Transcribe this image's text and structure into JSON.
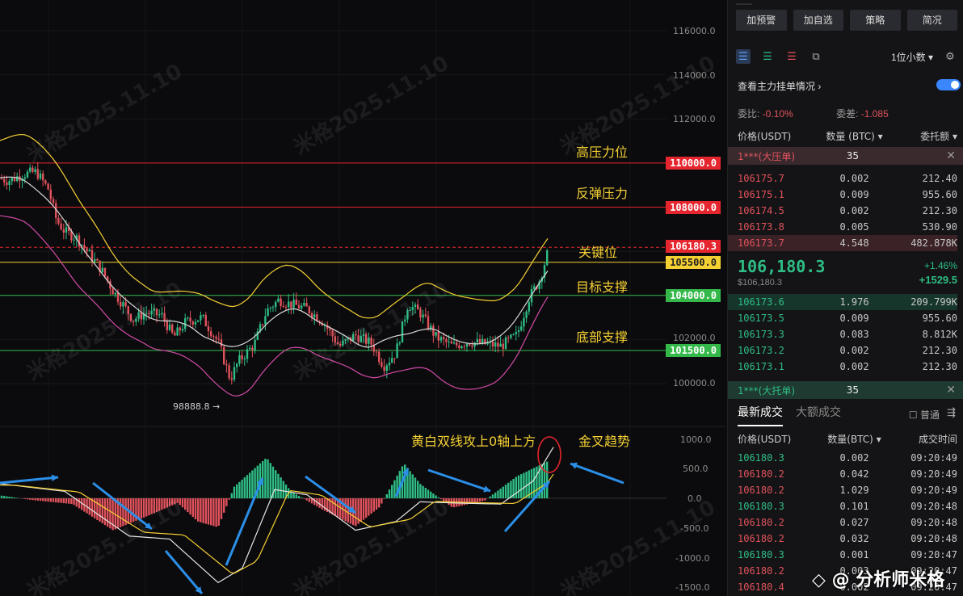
{
  "chart": {
    "y_axis_labels": [
      "116000.0",
      "114000.0",
      "112000.0",
      "110000.0",
      "108000.0",
      "106000.0",
      "104000.0",
      "102000.0",
      "100000.0"
    ],
    "macd_axis_labels": [
      "1000.0",
      "500.0",
      "0.0",
      "-500.0",
      "-1000.0",
      "-1500.0"
    ],
    "price_levels": [
      {
        "value": "110000.0",
        "color": "#e5262f",
        "note": "高压力位"
      },
      {
        "value": "108000.0",
        "color": "#e5262f",
        "note": "反弹压力"
      },
      {
        "value": "106180.3",
        "color": "#e5262f",
        "note": "关键位"
      },
      {
        "value": "105500.0",
        "color": "#f5d033",
        "note": ""
      },
      {
        "value": "104000.0",
        "color": "#35b84a",
        "note": "目标支撑"
      },
      {
        "value": "101500.0",
        "color": "#35b84a",
        "note": "底部支撑"
      }
    ],
    "low_label": "98888.8 →",
    "macd_notes": {
      "cross_text": "黄白双线攻上0轴上方",
      "trend_text": "金叉趋势"
    },
    "watermark": "米格2025.11.10",
    "brand": "分析师米格"
  },
  "panel": {
    "buttons": [
      "加预警",
      "加自选",
      "策略",
      "简况"
    ],
    "decimal_select": "1位小数",
    "order_toggle_label": "查看主力挂单情况",
    "ratio": {
      "label": "委比:",
      "value": "-0.10%",
      "diff_label": "委差:",
      "diff_value": "-1.085"
    },
    "book_headers": [
      "价格(USDT)",
      "数量 (BTC)",
      "委托额"
    ],
    "big_ask": {
      "label": "1***(大压单)",
      "value": "35"
    },
    "asks": [
      [
        "106175.7",
        "0.002",
        "212.40"
      ],
      [
        "106175.1",
        "0.009",
        "955.60"
      ],
      [
        "106174.5",
        "0.002",
        "212.30"
      ],
      [
        "106173.8",
        "0.005",
        "530.90"
      ],
      [
        "106173.7",
        "4.548",
        "482.878K"
      ]
    ],
    "last_price": "106,180.3",
    "last_price_usd": "$106,180.3",
    "change_pct": "+1.46%",
    "change_abs": "+1529.5",
    "bids": [
      [
        "106173.6",
        "1.976",
        "209.799K"
      ],
      [
        "106173.5",
        "0.009",
        "955.60"
      ],
      [
        "106173.3",
        "0.083",
        "8.812K"
      ],
      [
        "106173.2",
        "0.002",
        "212.30"
      ],
      [
        "106173.1",
        "0.002",
        "212.30"
      ]
    ],
    "big_bid": {
      "label": "1***(大托单)",
      "value": "35"
    },
    "trade_tabs": [
      "最新成交",
      "大额成交"
    ],
    "normal_label": "普通",
    "trade_headers": [
      "价格(USDT)",
      "数量(BTC)",
      "成交时间"
    ],
    "trades": [
      [
        "106180.3",
        "0.002",
        "09:20:49",
        "green"
      ],
      [
        "106180.2",
        "0.042",
        "09:20:49",
        "red"
      ],
      [
        "106180.2",
        "1.029",
        "09:20:49",
        "red"
      ],
      [
        "106180.3",
        "0.101",
        "09:20:48",
        "green"
      ],
      [
        "106180.2",
        "0.027",
        "09:20:48",
        "red"
      ],
      [
        "106180.2",
        "0.032",
        "09:20:48",
        "red"
      ],
      [
        "106180.3",
        "0.001",
        "09:20:47",
        "green"
      ],
      [
        "106180.2",
        "0.003",
        "09:20:47",
        "red"
      ],
      [
        "106180.4",
        "0.002",
        "09:20:47",
        "red"
      ]
    ]
  }
}
